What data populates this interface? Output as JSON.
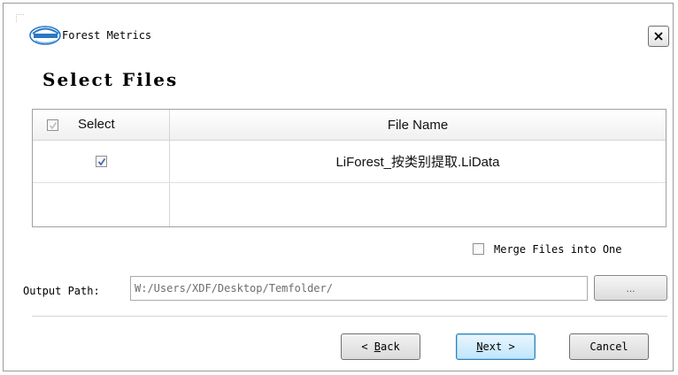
{
  "window": {
    "title": "Forest Metrics",
    "close_icon": "close-icon",
    "logo_icon": "lidar-logo-icon"
  },
  "page": {
    "heading": "Select Files"
  },
  "file_table": {
    "columns": [
      "Select",
      "File Name"
    ],
    "header_select_checked": true,
    "rows": [
      {
        "selected": true,
        "file_name": "LiForest_按类别提取.LiData"
      }
    ]
  },
  "options": {
    "merge_label": "Merge Files into One",
    "merge_checked": false
  },
  "output": {
    "label": "Output Path:",
    "value": "W:/Users/XDF/Desktop/Temfolder/",
    "browse_label": "..."
  },
  "buttons": {
    "back_prefix": "< ",
    "back_key": "B",
    "back_rest": "ack",
    "next_key": "N",
    "next_rest": "ext >",
    "cancel": "Cancel"
  },
  "colors": {
    "check": "#4a68b0",
    "accent_border": "#3c7fb1"
  }
}
